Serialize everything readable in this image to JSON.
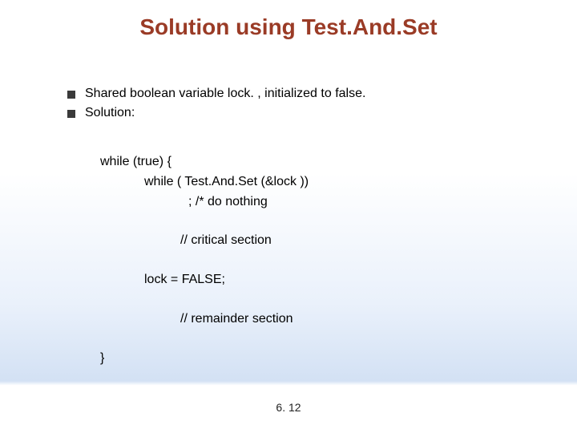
{
  "title": "Solution using Test.And.Set",
  "bullets": [
    "Shared boolean variable lock. , initialized to false.",
    "Solution:"
  ],
  "code": {
    "l1": "while (true) {",
    "l2": "while ( Test.And.Set (&lock ))",
    "l3": ";   /* do nothing",
    "l4": "//    critical section",
    "l5": "lock = FALSE;",
    "l6": "//     remainder section",
    "l7": "}"
  },
  "page_number": "6. 12"
}
